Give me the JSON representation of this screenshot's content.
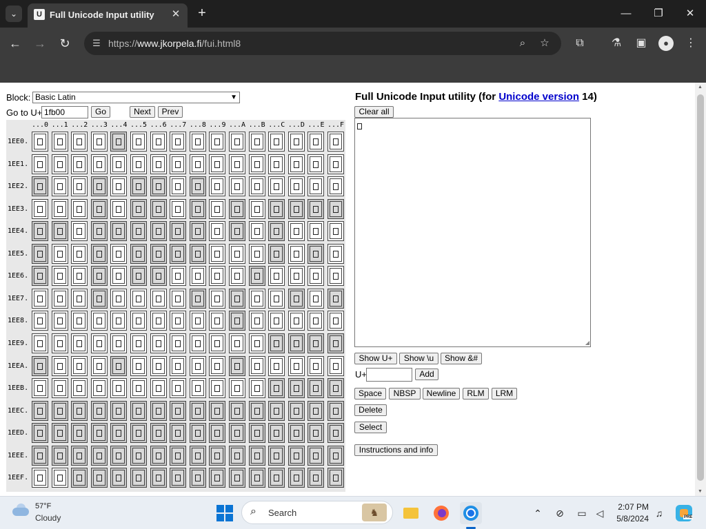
{
  "browser": {
    "tab_title": "Full Unicode Input utility",
    "tab_favicon": "U",
    "url_scheme": "https://",
    "url_host": "www.jkorpela.fi",
    "url_path": "/fui.html8",
    "icons": {
      "tab_list": "chevron-down-icon",
      "close": "close-icon",
      "new_tab": "plus-icon",
      "back": "back-arrow-icon",
      "forward": "forward-arrow-icon",
      "reload": "reload-icon",
      "site_info": "tune-icon",
      "zoom": "magnifier-icon",
      "bookmark": "star-icon",
      "extensions": "puzzle-icon",
      "labs": "flask-icon",
      "side_panel": "side-panel-icon",
      "profile": "person-icon",
      "menu": "kebab-menu-icon"
    }
  },
  "page": {
    "block_label": "Block:",
    "block_value": "Basic Latin",
    "goto_label": "Go to U+",
    "goto_value": "1fb00",
    "go_button": "Go",
    "next_button": "Next",
    "prev_button": "Prev",
    "grid": {
      "columns": [
        "...0",
        "...1",
        "...2",
        "...3",
        "...4",
        "...5",
        "...6",
        "...7",
        "...8",
        "...9",
        "...A",
        "...B",
        "...C",
        "...D",
        "...E",
        "...F"
      ],
      "rows": [
        "1EE0.",
        "1EE1.",
        "1EE2.",
        "1EE3.",
        "1EE4.",
        "1EE5.",
        "1EE6.",
        "1EE7.",
        "1EE8.",
        "1EE9.",
        "1EEA.",
        "1EEB.",
        "1EEC.",
        "1EED.",
        "1EEE.",
        "1EEF."
      ],
      "gray_pattern": [
        "0000100000000000",
        "0000000000000000",
        "1001011010000000",
        "0001011010101111",
        "1101111110101000",
        "1001011110001010",
        "1001011000010000",
        "0001000010100101",
        "0000000000100000",
        "0000000000001111",
        "1000100000100000",
        "0000000000001111",
        "1111111111111111",
        "1111111111111111",
        "1111111111111111",
        "0011111111111111"
      ]
    },
    "title_prefix": "Full Unicode Input utility (for ",
    "title_link": "Unicode version",
    "title_suffix": " 14)",
    "clear_all": "Clear all",
    "show_buttons": [
      "Show U+",
      "Show \\u",
      "Show &#"
    ],
    "uplus_label": "U+",
    "uplus_value": "",
    "add_button": "Add",
    "char_buttons": [
      "Space",
      "NBSP",
      "Newline",
      "RLM",
      "LRM"
    ],
    "delete_button": "Delete",
    "select_button": "Select",
    "instructions_button": "Instructions and info"
  },
  "taskbar": {
    "weather_temp": "57°F",
    "weather_desc": "Cloudy",
    "search_placeholder": "Search",
    "time": "2:07 PM",
    "date": "5/8/2024",
    "copilot_badge": "PRE"
  }
}
